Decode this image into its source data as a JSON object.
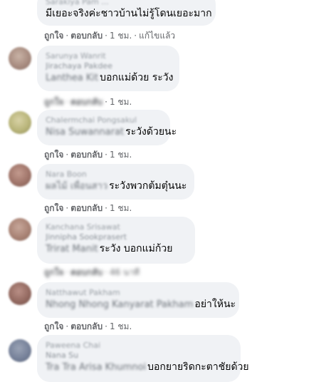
{
  "actions": {
    "like": "ถูกใจ",
    "reply": "ตอบกลับ",
    "separator": "·",
    "edited": "แก้ไขแล้ว"
  },
  "comments": [
    {
      "name": "Sarakiya Pam ...",
      "text": "มีเยอะจริงค่ะชาวบ้านไม่รู้โดนเยอะมาก",
      "time": "1 ชม."
    },
    {
      "name": "Sarunya Wanrit",
      "sub": "Jirachaya Pakdee",
      "mention": "Lanthea Kit",
      "text": "บอกแม่ด้วย ระวัง",
      "time": "1 ชม."
    },
    {
      "name": "Chalermchai Pongsakul",
      "mention": "Nisa Suwannarat",
      "text": "ระวังด้วยนะ",
      "time": "1 ชม."
    },
    {
      "name": "Nara Boon",
      "mention": "ผลไม้ เพื่อนสาว",
      "text": "ระวังพวกต้มตุ๋นนะ",
      "time": "1 ชม."
    },
    {
      "name": "Kanchana Srisawat",
      "sub": "Jinnipha Sookprasert",
      "mention": "Trirat Manit",
      "text": "ระวัง บอกแม่ก้วย",
      "time": "46 นาที"
    },
    {
      "name": "Natthawut Pakham",
      "mention": "Nhong Nhong Kanyarat Pakham",
      "text": "อย่าให้นะ",
      "time": "1 ชม."
    },
    {
      "name": "Paweena Chai",
      "sub": "Nana Su",
      "mention": "Tra Tra Arisa Khumnoi",
      "text": "บอกยายริดกะตาชัยด้วย",
      "time": ""
    }
  ]
}
